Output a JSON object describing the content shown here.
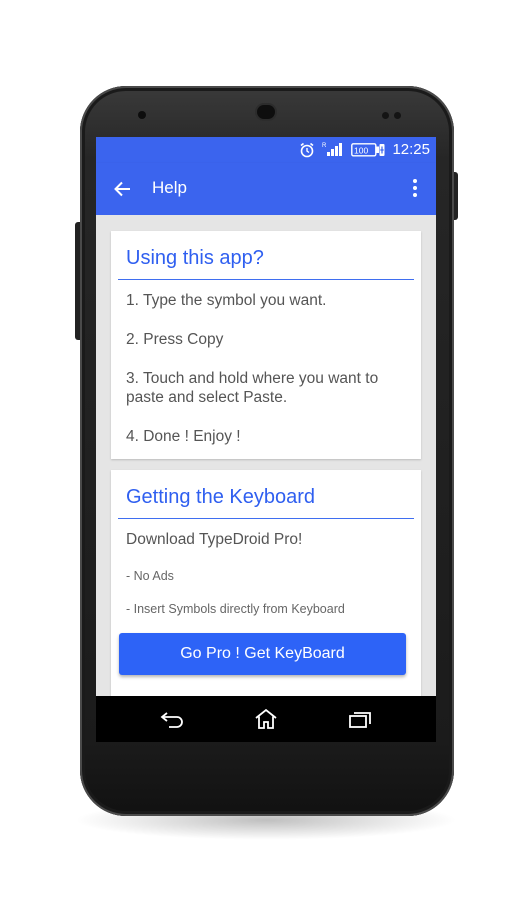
{
  "status_bar": {
    "time": "12:25",
    "battery_level": "100",
    "icons": [
      "alarm-icon",
      "signal-icon",
      "battery-icon"
    ]
  },
  "app_bar": {
    "title": "Help",
    "back_icon": "arrow-left-icon",
    "menu_icon": "more-vert-icon"
  },
  "using_card": {
    "title": "Using this app?",
    "steps": [
      "1. Type the symbol you want.",
      "2. Press Copy",
      "3. Touch and hold where you want to paste and select Paste.",
      "4. Done ! Enjoy !"
    ]
  },
  "keyboard_card": {
    "title": "Getting the Keyboard",
    "download_text": "Download TypeDroid Pro!",
    "features": [
      "- No Ads",
      "- Insert Symbols directly from Keyboard"
    ],
    "button_label": "Go Pro ! Get KeyBoard"
  },
  "nav_bar": {
    "icons": [
      "nav-back-icon",
      "nav-home-icon",
      "nav-recents-icon"
    ]
  },
  "colors": {
    "primary": "#3b64ee",
    "accent_text": "#2f5ff0",
    "button": "#2d63f7",
    "background": "#e5e5e5"
  }
}
